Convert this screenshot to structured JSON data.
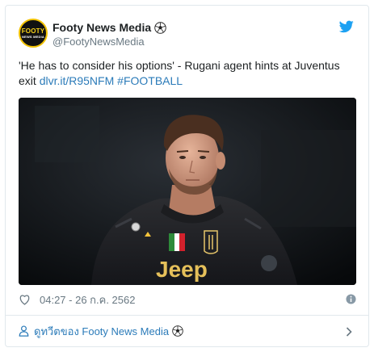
{
  "author": {
    "display_name": "Footy News Media",
    "handle": "@FootyNewsMedia",
    "avatar": {
      "line1": "FOOTY",
      "line2": "NEWS MEDIA"
    }
  },
  "tweet": {
    "text": "'He has to consider his options' - Rugani agent hints at Juventus exit ",
    "link": "dlvr.it/R95NFM",
    "hashtag": "#FOOTBALL"
  },
  "media": {
    "jersey_sponsor": "Jeep"
  },
  "meta": {
    "timestamp": "04:27 - 26 ก.ค. 2562"
  },
  "footer": {
    "view_profile_label": "ดูทวีตของ Footy News Media"
  },
  "colors": {
    "link": "#2b7bb9",
    "twitter_blue": "#1da1f2",
    "muted": "#697882",
    "border": "#e1e8ed"
  },
  "icons": [
    "soccer-ball-icon",
    "twitter-bird-icon",
    "heart-icon",
    "info-icon",
    "person-icon",
    "chevron-right-icon"
  ]
}
